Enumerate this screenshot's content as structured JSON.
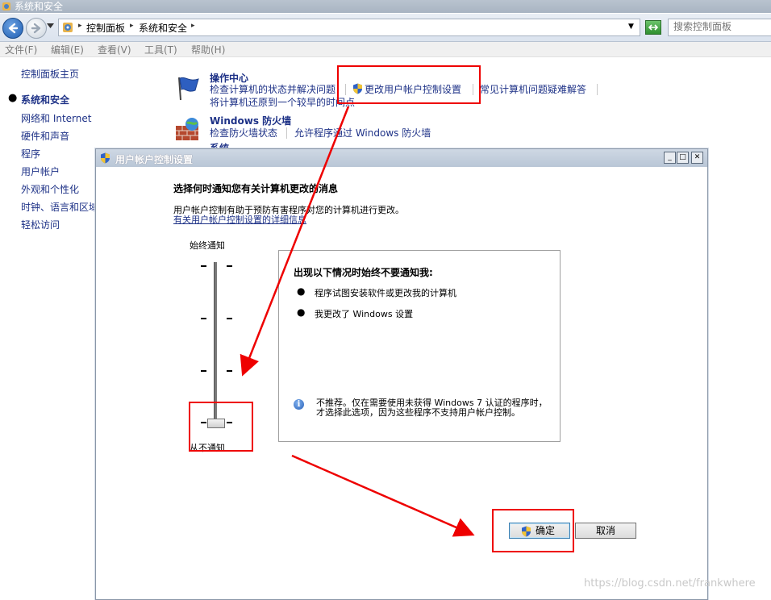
{
  "window": {
    "title": "系统和安全"
  },
  "address_bar": {
    "breadcrumbs": [
      "控制面板",
      "系统和安全"
    ],
    "search_placeholder": "搜索控制面板"
  },
  "menu": [
    "文件(F)",
    "编辑(E)",
    "查看(V)",
    "工具(T)",
    "帮助(H)"
  ],
  "sidebar": {
    "home": "控制面板主页",
    "current": "系统和安全",
    "items": [
      "网络和 Internet",
      "硬件和声音",
      "程序",
      "用户帐户",
      "外观和个性化",
      "时钟、语言和区域",
      "轻松访问"
    ]
  },
  "categories": {
    "action_center": {
      "title": "操作中心",
      "links": [
        "检查计算机的状态并解决问题",
        "更改用户帐户控制设置",
        "常见计算机问题疑难解答",
        "将计算机还原到一个较早的时间点"
      ]
    },
    "firewall": {
      "title": "Windows 防火墙",
      "links": [
        "检查防火墙状态",
        "允许程序通过 Windows 防火墙"
      ]
    },
    "system_partial": "系统"
  },
  "uac_dialog": {
    "title": "用户帐户控制设置",
    "heading": "选择何时通知您有关计算机更改的消息",
    "description": "用户帐户控制有助于预防有害程序对您的计算机进行更改。",
    "link": "有关用户帐户控制设置的详细信息",
    "slider": {
      "top_label": "始终通知",
      "bottom_label": "从不通知",
      "levels": 4,
      "selected_level": 1
    },
    "info": {
      "heading": "出现以下情况时始终不要通知我:",
      "items": [
        "程序试图安装软件或更改我的计算机",
        "我更改了 Windows 设置"
      ],
      "note": "不推荐。仅在需要使用未获得 Windows 7 认证的程序时，才选择此选项，因为这些程序不支持用户帐户控制。"
    },
    "buttons": {
      "ok": "确定",
      "cancel": "取消"
    }
  },
  "watermark": "https://blog.csdn.net/frankwhere",
  "colors": {
    "link": "#1e3287",
    "annotation": "#e00000"
  }
}
